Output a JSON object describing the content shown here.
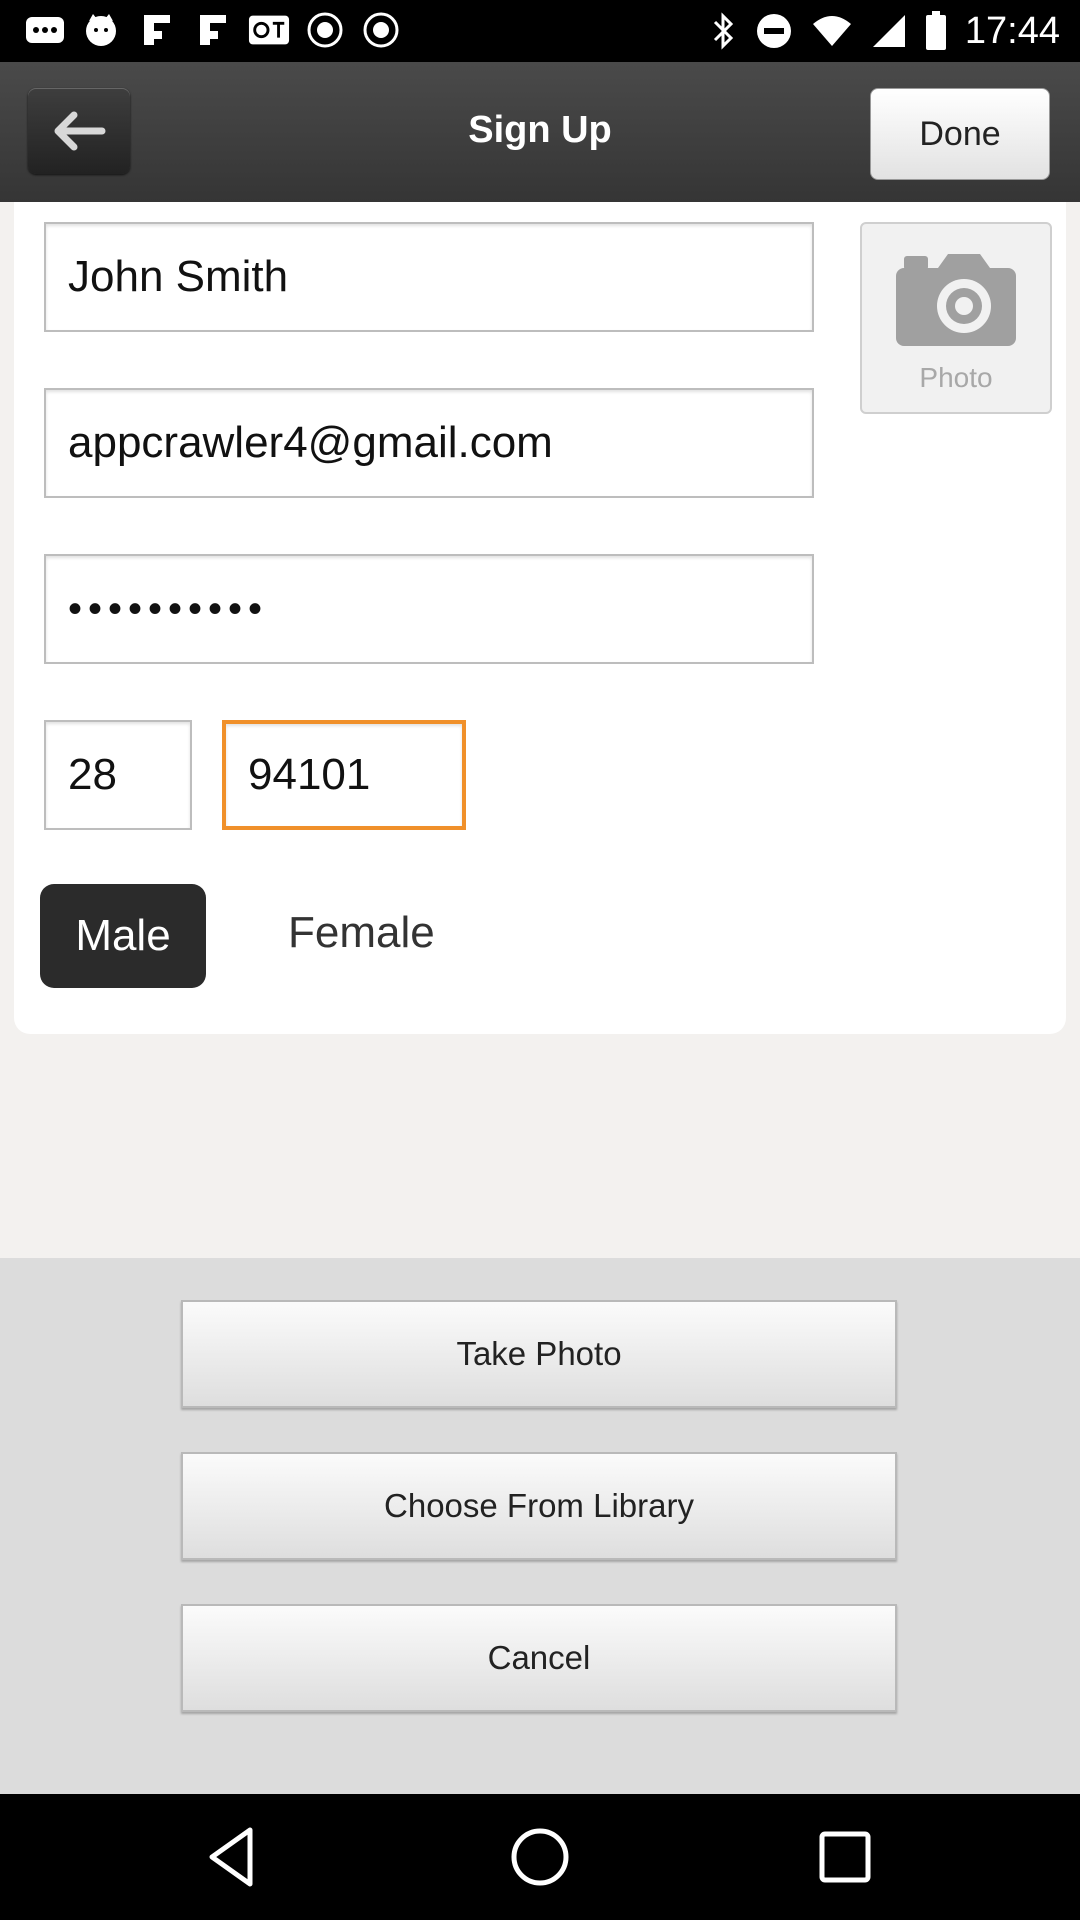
{
  "status_bar": {
    "time": "17:44",
    "left_icons": [
      "more-icon",
      "cat-icon",
      "flipboard-icon",
      "flipboard-icon",
      "qt-icon",
      "news-icon",
      "news-icon"
    ],
    "right_icons": [
      "bluetooth-icon",
      "dnd-icon",
      "wifi-icon",
      "signal-icon",
      "battery-icon"
    ]
  },
  "header": {
    "title": "Sign Up",
    "done_label": "Done"
  },
  "form": {
    "name_value": "John Smith",
    "email_value": "appcrawler4@gmail.com",
    "password_value": "••••••••••",
    "age_value": "28",
    "zip_value": "94101",
    "photo_label": "Photo",
    "gender": {
      "male_label": "Male",
      "female_label": "Female",
      "selected": "Male"
    }
  },
  "action_sheet": {
    "take_photo_label": "Take Photo",
    "choose_library_label": "Choose From Library",
    "cancel_label": "Cancel"
  },
  "colors": {
    "accent_orange": "#f0902a",
    "header_dark": "#3f3f3f",
    "selected_gender": "#2b2b2b"
  }
}
